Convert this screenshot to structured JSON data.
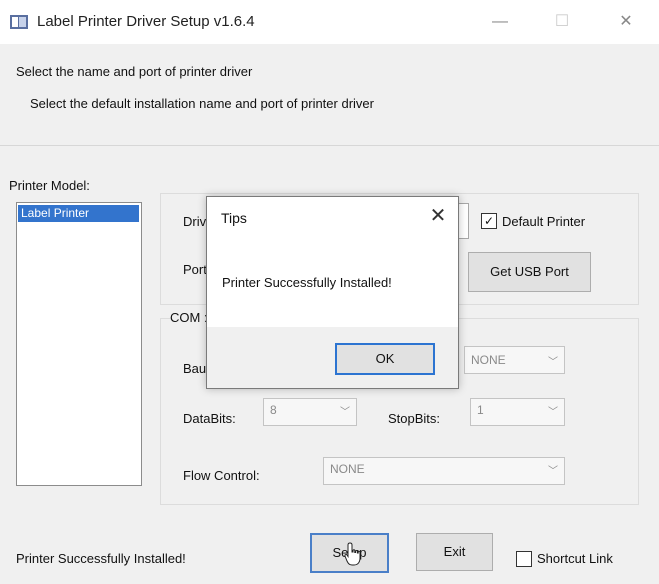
{
  "window": {
    "title": "Label Printer Driver Setup v1.6.4"
  },
  "header": {
    "line1": "Select the name and port of printer driver",
    "line2": "Select the default installation name and port of printer driver"
  },
  "printer_model": {
    "label": "Printer Model:",
    "items": [
      "Label Printer"
    ]
  },
  "driver_group": {
    "driver_label": "Driv",
    "port_label": "Port",
    "default_printer_label": "Default Printer",
    "default_printer_checked": true,
    "get_usb_port_label": "Get USB Port"
  },
  "com_group": {
    "label": "COM :",
    "baud_label": "Bau",
    "parity_value": "NONE",
    "databits_label": "DataBits:",
    "databits_value": "8",
    "stopbits_label": "StopBits:",
    "stopbits_value": "1",
    "flow_label": "Flow Control:",
    "flow_value": "NONE"
  },
  "footer": {
    "status": "Printer Successfully Installed!",
    "setup_label": "Setup",
    "exit_label": "Exit",
    "shortcut_label": "Shortcut Link",
    "shortcut_checked": false
  },
  "dialog": {
    "title": "Tips",
    "message": "Printer Successfully Installed!",
    "ok_label": "OK"
  },
  "colors": {
    "accent": "#3374cd",
    "focus": "#2c74d1"
  },
  "icons": [
    "app-icon",
    "minimize-icon",
    "maximize-icon",
    "close-icon",
    "chevron-down-icon",
    "checkmark-icon",
    "cursor-icon"
  ]
}
